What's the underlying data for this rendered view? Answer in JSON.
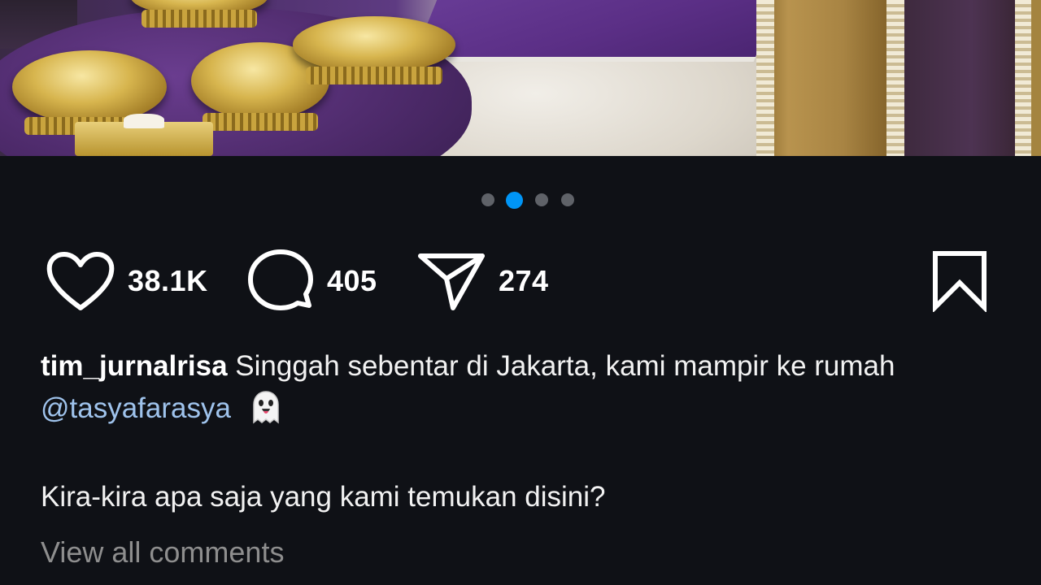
{
  "post": {
    "photo": {
      "carousel": {
        "total": 4,
        "active_index": 1
      }
    },
    "actions": {
      "like_count": "38.1K",
      "comment_count": "405",
      "share_count": "274",
      "like_icon": "heart-icon",
      "comment_icon": "comment-bubble-icon",
      "share_icon": "paper-plane-icon",
      "save_icon": "bookmark-icon"
    },
    "caption": {
      "username": "tim_jurnalrisa",
      "text": "Singgah sebentar di Jakarta, kami mampir ke rumah",
      "mention": "@tasyafarasya",
      "emoji": "👻",
      "question": "Kira-kira apa saja yang kami temukan disini?"
    },
    "view_all_comments": "View all comments"
  },
  "colors": {
    "background": "#0f1116",
    "accent": "#0095f6",
    "mention": "#9fc3ec",
    "muted": "#8e8e8e"
  }
}
